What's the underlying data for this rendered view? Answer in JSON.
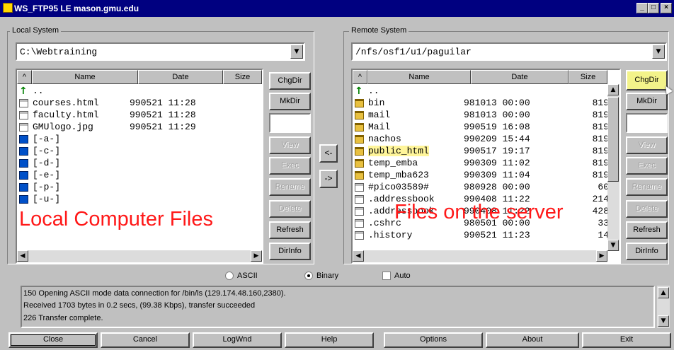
{
  "window": {
    "title": "WS_FTP95 LE mason.gmu.edu",
    "controls": {
      "minimize": "_",
      "maximize": "□",
      "close": "×"
    }
  },
  "local": {
    "group_label": "Local System",
    "path": "C:\\Webtraining",
    "columns": {
      "sort": "^",
      "name": "Name",
      "date": "Date",
      "size": "Size"
    },
    "parent": "..",
    "files": [
      {
        "name": "courses.html",
        "date": "990521 11:28",
        "icon": "file-icon"
      },
      {
        "name": "faculty.html",
        "date": "990521 11:28",
        "icon": "file-icon"
      },
      {
        "name": "GMUlogo.jpg",
        "date": "990521 11:29",
        "icon": "file-icon"
      },
      {
        "name": "[-a-]",
        "icon": "drive-icon"
      },
      {
        "name": "[-c-]",
        "icon": "drive-icon"
      },
      {
        "name": "[-d-]",
        "icon": "drive-icon"
      },
      {
        "name": "[-e-]",
        "icon": "drive-icon"
      },
      {
        "name": "[-p-]",
        "icon": "drive-icon"
      },
      {
        "name": "[-u-]",
        "icon": "drive-icon"
      }
    ],
    "buttons": {
      "chgdir": "ChgDir",
      "mkdir": "MkDir",
      "view": "View",
      "exec": "Exec",
      "rename": "Rename",
      "delete": "Delete",
      "refresh": "Refresh",
      "dirinfo": "DirInfo"
    },
    "overlay_caption": "Local Computer Files"
  },
  "remote": {
    "group_label": "Remote System",
    "path": "/nfs/osf1/u1/paguilar",
    "columns": {
      "sort": "^",
      "name": "Name",
      "date": "Date",
      "size": "Size"
    },
    "parent": "..",
    "files": [
      {
        "name": "bin",
        "date": "981013 00:00",
        "size": "819",
        "icon": "folder-icon"
      },
      {
        "name": "mail",
        "date": "981013 00:00",
        "size": "819",
        "icon": "folder-icon"
      },
      {
        "name": "Mail",
        "date": "990519 16:08",
        "size": "819",
        "icon": "folder-icon"
      },
      {
        "name": "nachos",
        "date": "990209 15:44",
        "size": "819",
        "icon": "folder-icon"
      },
      {
        "name": "public_html",
        "date": "990517 19:17",
        "size": "819",
        "icon": "folder-icon",
        "highlighted": true
      },
      {
        "name": "temp_emba",
        "date": "990309 11:02",
        "size": "819",
        "icon": "folder-icon"
      },
      {
        "name": "temp_mba623",
        "date": "990309 11:04",
        "size": "819",
        "icon": "folder-icon"
      },
      {
        "name": "#pico03589#",
        "date": "980928 00:00",
        "size": "60",
        "icon": "file-icon"
      },
      {
        "name": ".addressbook",
        "date": "990408 11:22",
        "size": "214",
        "icon": "file-icon"
      },
      {
        "name": ".addressbook",
        "date": "990408 11:22",
        "size": "428",
        "icon": "file-icon"
      },
      {
        "name": ".cshrc",
        "date": "980501 00:00",
        "size": "33",
        "icon": "file-icon"
      },
      {
        "name": ".history",
        "date": "990521 11:23",
        "size": "14",
        "icon": "file-icon"
      }
    ],
    "buttons": {
      "chgdir": "ChgDir",
      "mkdir": "MkDir",
      "view": "View",
      "exec": "Exec",
      "rename": "Rename",
      "delete": "Delete",
      "refresh": "Refresh",
      "dirinfo": "DirInfo"
    },
    "overlay_caption": "Files on the server"
  },
  "transfer": {
    "to_local": "<-",
    "to_remote": "->"
  },
  "modes": {
    "ascii": "ASCII",
    "binary": "Binary",
    "auto": "Auto",
    "selected": "Binary"
  },
  "log": [
    "150 Opening ASCII mode data connection for /bin/ls (129.174.48.160,2380).",
    "Received 1703 bytes in 0.2 secs, (99.38 Kbps), transfer succeeded",
    "226 Transfer complete."
  ],
  "bottom_buttons": {
    "close": "Close",
    "cancel": "Cancel",
    "logwnd": "LogWnd",
    "help": "Help",
    "options": "Options",
    "about": "About",
    "exit": "Exit"
  }
}
